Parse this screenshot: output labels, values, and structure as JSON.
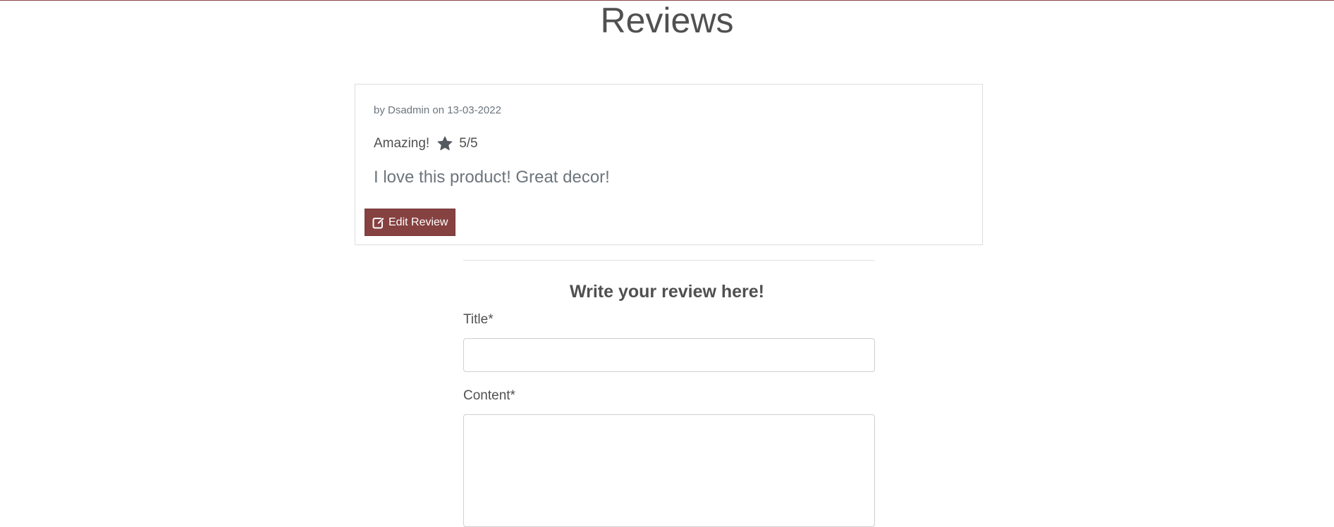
{
  "page": {
    "title": "Reviews"
  },
  "review": {
    "meta": "by Dsadmin on 13-03-2022",
    "title": "Amazing!",
    "rating_text": "5/5",
    "body": "I love this product! Great decor!",
    "edit_label": "Edit Review"
  },
  "form": {
    "heading": "Write your review here!",
    "title_label": "Title*",
    "title_value": "",
    "content_label": "Content*",
    "content_value": ""
  },
  "icons": {
    "rating": "star-icon",
    "edit": "edit-icon"
  },
  "colors": {
    "accent": "#864141",
    "accent_line": "#8a4b4b",
    "text": "#505050",
    "muted": "#6c757d"
  }
}
